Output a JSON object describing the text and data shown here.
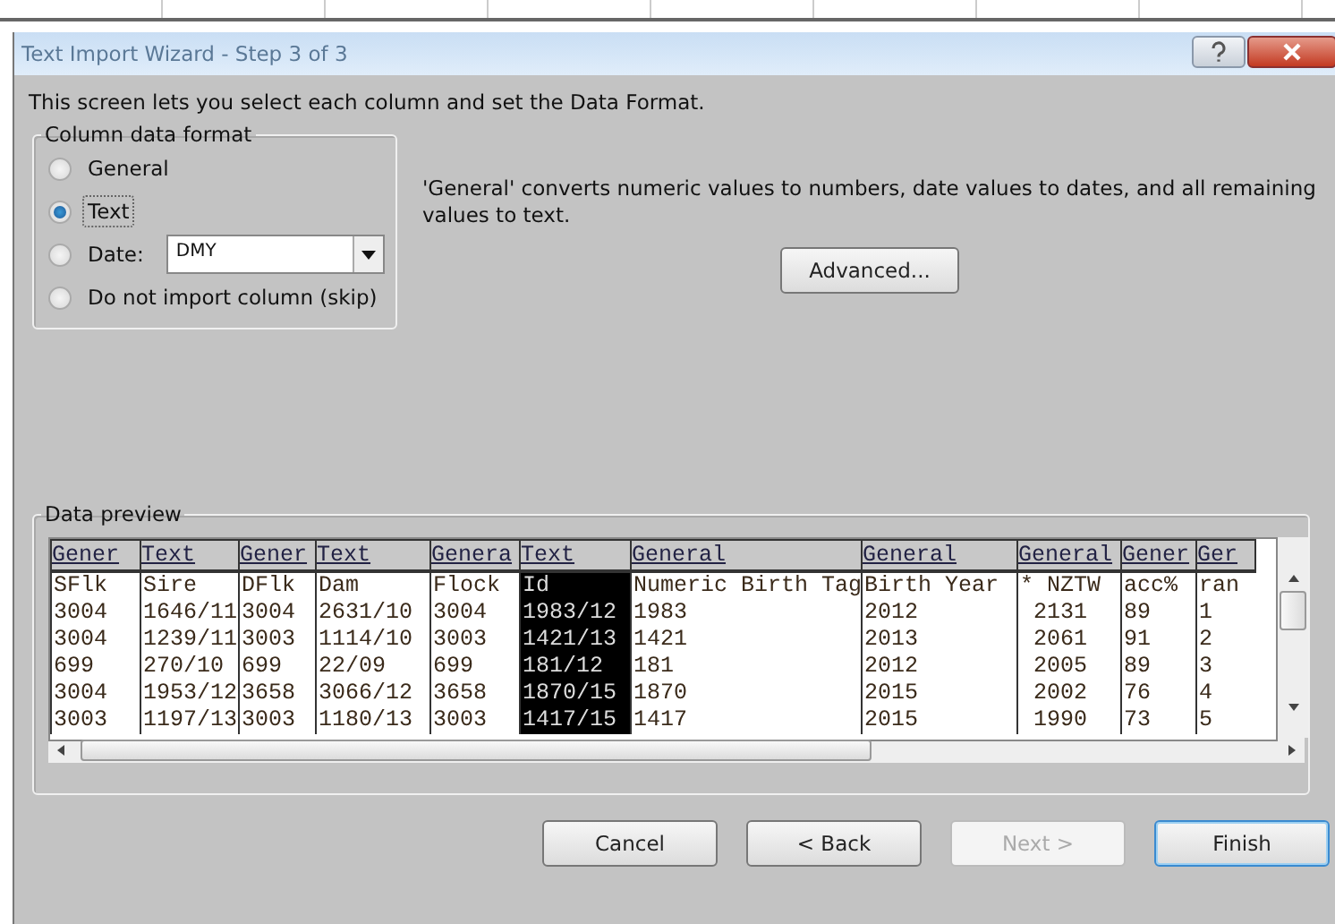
{
  "window": {
    "title": "Text Import Wizard - Step 3 of 3"
  },
  "intro": "This screen lets you select each column and set the Data Format.",
  "column_format": {
    "title": "Column data format",
    "options": [
      {
        "kind": "radio",
        "label": "General",
        "selected": false
      },
      {
        "kind": "radio",
        "label": "Text",
        "selected": true
      },
      {
        "kind": "date",
        "label": "Date:",
        "selected": false,
        "value": "DMY"
      },
      {
        "kind": "radio",
        "label": "Do not import column (skip)",
        "selected": false
      }
    ]
  },
  "description": "'General' converts numeric values to numbers, date values to dates, and all remaining values to text.",
  "advanced_button": "Advanced...",
  "preview": {
    "title": "Data preview",
    "columns": [
      {
        "format": "Gener",
        "selected": false
      },
      {
        "format": "Text",
        "selected": false
      },
      {
        "format": "Gener",
        "selected": false
      },
      {
        "format": "Text",
        "selected": false
      },
      {
        "format": "Genera",
        "selected": false
      },
      {
        "format": "Text",
        "selected": true
      },
      {
        "format": "General",
        "selected": false
      },
      {
        "format": "General",
        "selected": false
      },
      {
        "format": "General",
        "selected": false
      },
      {
        "format": "Gener",
        "selected": false
      },
      {
        "format": "Ger",
        "selected": false
      }
    ],
    "rows": [
      [
        "SFlk",
        "Sire",
        "DFlk",
        "Dam",
        "Flock",
        "Id",
        "Numeric Birth Tag",
        "Birth Year",
        "* NZTW",
        "acc%",
        "ran"
      ],
      [
        "3004",
        "1646/11",
        "3004",
        "2631/10",
        "3004",
        "1983/12",
        "1983",
        "2012",
        " 2131",
        "89",
        "1"
      ],
      [
        "3004",
        "1239/11",
        "3003",
        "1114/10",
        "3003",
        "1421/13",
        "1421",
        "2013",
        " 2061",
        "91",
        "2"
      ],
      [
        "699",
        "270/10",
        "699",
        "22/09",
        "699",
        "181/12",
        "181",
        "2012",
        " 2005",
        "89",
        "3"
      ],
      [
        "3004",
        "1953/12",
        "3658",
        "3066/12",
        "3658",
        "1870/15",
        "1870",
        "2015",
        " 2002",
        "76",
        "4"
      ],
      [
        "3003",
        "1197/13",
        "3003",
        "1180/13",
        "3003",
        "1417/15",
        "1417",
        "2015",
        " 1990",
        "73",
        "5"
      ]
    ]
  },
  "buttons": [
    {
      "label": "Cancel",
      "disabled": false,
      "default": false
    },
    {
      "label": "< Back",
      "disabled": false,
      "default": false
    },
    {
      "label": "Next >",
      "disabled": true,
      "default": false
    },
    {
      "label": "Finish",
      "disabled": false,
      "default": true
    }
  ]
}
